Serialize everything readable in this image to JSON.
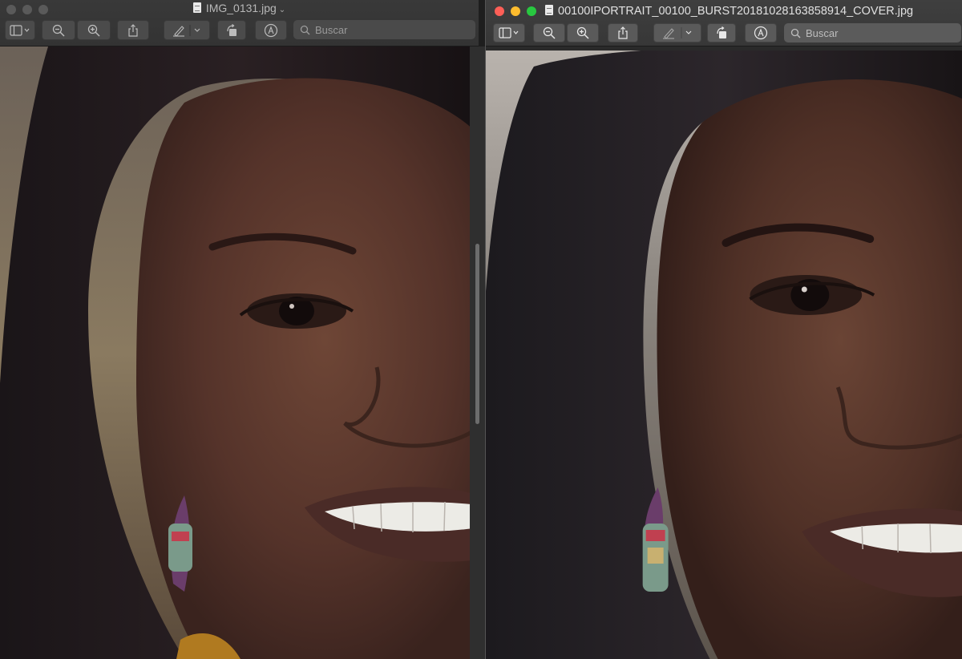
{
  "left_window": {
    "title": "IMG_0131.jpg",
    "search": {
      "placeholder": "Buscar"
    },
    "toolbar": [
      "sidebar-icon",
      "zoom-out-icon",
      "zoom-in-icon",
      "share-icon",
      "markup-pen-icon",
      "rotate-icon",
      "annotate-icon"
    ]
  },
  "right_window": {
    "title": "00100IPORTRAIT_00100_BURST20181028163858914_COVER.jpg",
    "search": {
      "placeholder": "Buscar"
    },
    "toolbar": [
      "sidebar-icon",
      "zoom-out-icon",
      "zoom-in-icon",
      "share-icon",
      "markup-pen-icon",
      "rotate-icon",
      "annotate-icon"
    ]
  },
  "colors": {
    "traffic_red": "#fe5f57",
    "traffic_yellow": "#febc2e",
    "traffic_green": "#28c840",
    "toolbar_bg": "#3b3b3b"
  }
}
